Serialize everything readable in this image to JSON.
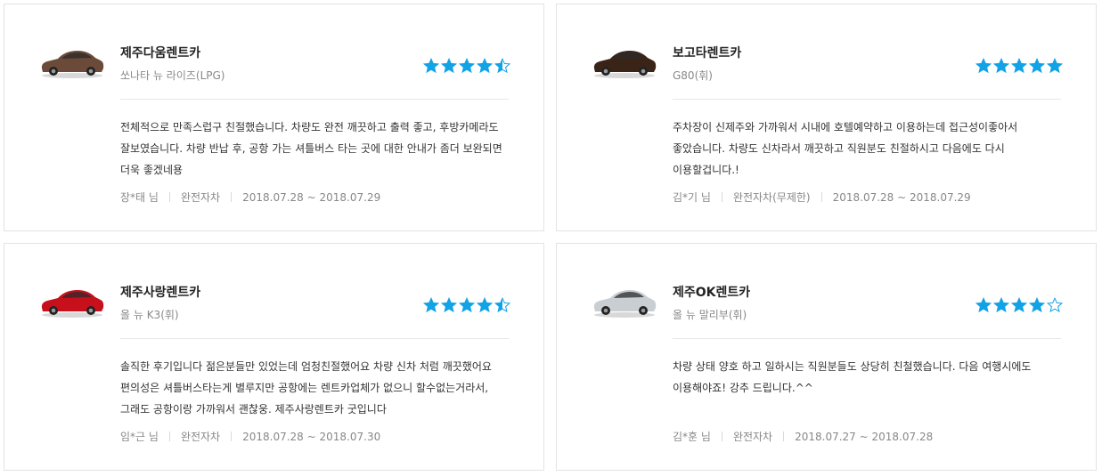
{
  "colors": {
    "star": "#12a2e6",
    "card_border": "#e3e3e3",
    "muted_text": "#888888"
  },
  "reviews": [
    {
      "company": "제주다움렌트카",
      "model": "쏘나타 뉴 라이즈(LPG)",
      "car_color": "#6b4a3a",
      "rating": 4.5,
      "text": "전체적으로 만족스럽구 친절했습니다. 차량도 완전 깨끗하고 출력 좋고, 후방카메라도 잘보였습니다. 차량 반납 후, 공항 가는 셔틀버스 타는 곳에 대한 안내가 좀더 보완되면 더욱 좋겠네용",
      "author": "장*태 님",
      "insurance": "완전자차",
      "period": "2018.07.28 ~ 2018.07.29"
    },
    {
      "company": "보고타렌트카",
      "model": "G80(휘)",
      "car_color": "#3a2418",
      "rating": 5,
      "text": "주차장이 신제주와 가까워서 시내에 호텔예약하고 이용하는데 접근성이좋아서 좋았습니다. 차량도 신차라서 깨끗하고 직원분도 친절하시고 다음에도 다시 이용할겁니다.!",
      "author": "김*기 님",
      "insurance": "완전자차(무제한)",
      "period": "2018.07.28 ~ 2018.07.29"
    },
    {
      "company": "제주사랑렌트카",
      "model": "올 뉴 K3(휘)",
      "car_color": "#c8101c",
      "rating": 4.5,
      "text": "솔직한 후기입니다 젊은분들만 있었는데 엄청친절했어요 차량 신차 처럼 깨끗했어요 편의성은 셔틀버스타는게 별루지만 공항에는 렌트카업체가 없으니 할수없는거라서,그래도 공항이랑 가까워서 괜찮웅. 제주사랑렌트카 굿입니다",
      "author": "임*근 님",
      "insurance": "완전자차",
      "period": "2018.07.28 ~ 2018.07.30"
    },
    {
      "company": "제주OK렌트카",
      "model": "올 뉴 말리부(휘)",
      "car_color": "#c9ced3",
      "rating": 4,
      "text": "차량 상태 양호 하고 일하시는 직원분들도 상당히 친철했습니다. 다음 여행시에도 이용해야죠! 강추 드립니다.^^",
      "author": "김*훈 님",
      "insurance": "완전자차",
      "period": "2018.07.27 ~ 2018.07.28"
    }
  ]
}
